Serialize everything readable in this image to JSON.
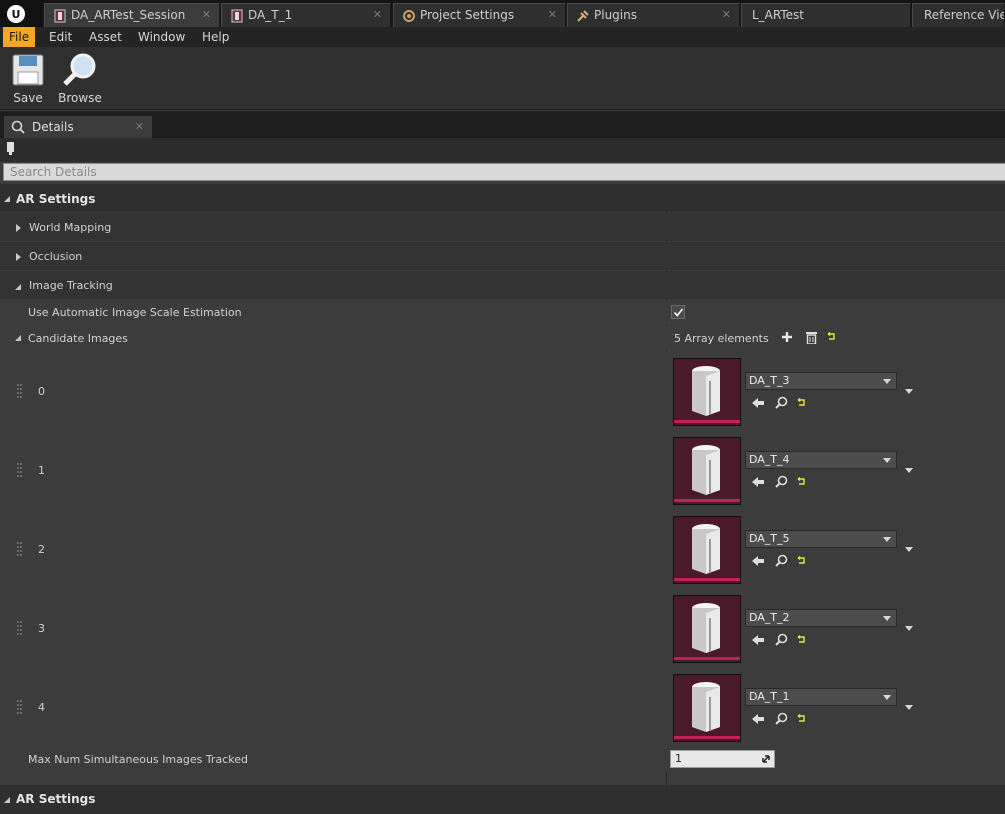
{
  "tabs": [
    {
      "label": "DA_ARTest_Session",
      "icon": "data-asset-icon",
      "active": true
    },
    {
      "label": "DA_T_1",
      "icon": "data-asset-icon",
      "active": false
    },
    {
      "label": "Project Settings",
      "icon": "settings-gear-icon",
      "active": false
    },
    {
      "label": "Plugins",
      "icon": "plug-icon",
      "active": false
    },
    {
      "label": "L_ARTest",
      "icon": "",
      "active": false
    },
    {
      "label": "Reference Viewer",
      "icon": "",
      "active": false
    }
  ],
  "menu": [
    "File",
    "Edit",
    "Asset",
    "Window",
    "Help"
  ],
  "toolbar": {
    "save_label": "Save",
    "browse_label": "Browse"
  },
  "details_tab": {
    "label": "Details"
  },
  "search": {
    "placeholder": "Search Details"
  },
  "details": {
    "category": "AR Settings",
    "world_mapping": "World Mapping",
    "occlusion": "Occlusion",
    "image_tracking": "Image Tracking",
    "auto_scale_label": "Use Automatic Image Scale Estimation",
    "auto_scale_checked": true,
    "candidate_label": "Candidate Images",
    "array_count": "5 Array elements",
    "elements": [
      {
        "index": "0",
        "asset": "DA_T_3"
      },
      {
        "index": "1",
        "asset": "DA_T_4"
      },
      {
        "index": "2",
        "asset": "DA_T_5"
      },
      {
        "index": "3",
        "asset": "DA_T_2"
      },
      {
        "index": "4",
        "asset": "DA_T_1"
      }
    ],
    "max_tracked_label": "Max Num Simultaneous Images Tracked",
    "max_tracked_value": "1",
    "category2": "AR Settings"
  },
  "colors": {
    "accent": "#f5a623",
    "thumb_bg": "#4a1a2b",
    "thumb_bar": "#c31f59"
  }
}
